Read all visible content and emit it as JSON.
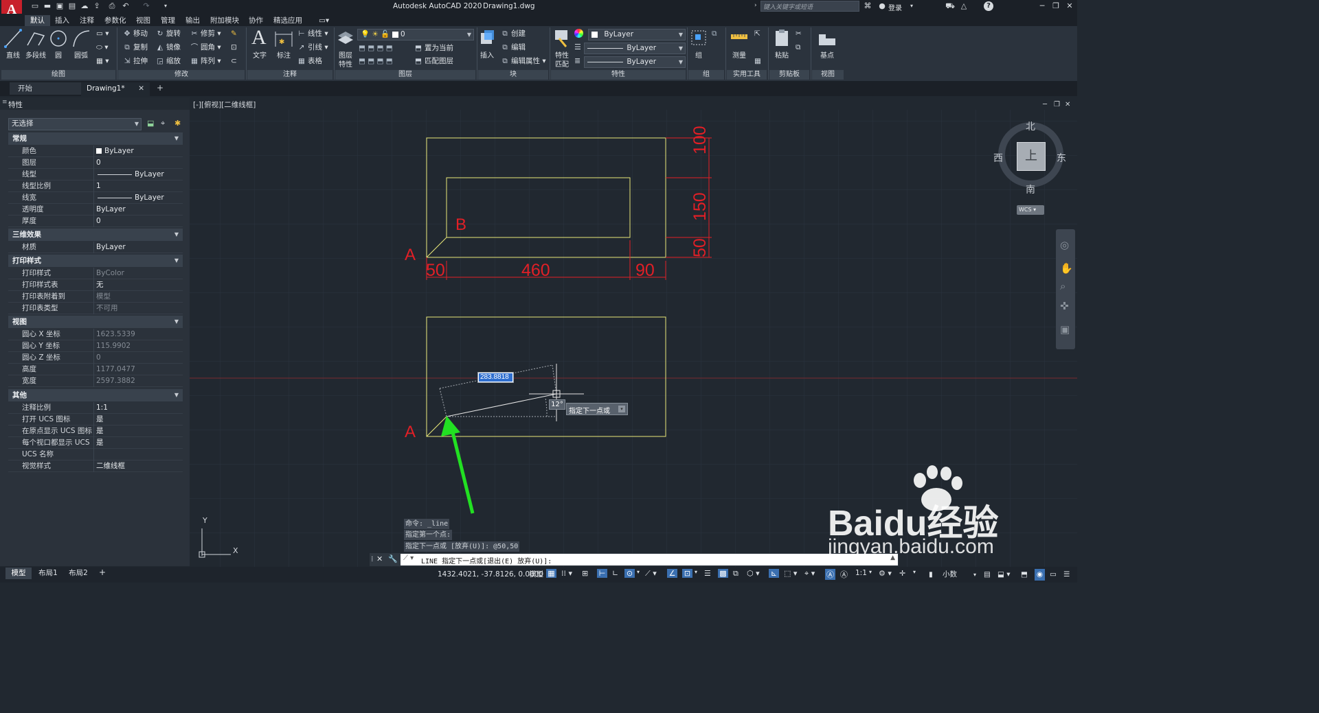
{
  "app": {
    "title": "Autodesk AutoCAD 2020",
    "document": "Drawing1.dwg",
    "search_placeholder": "键入关键字或短语",
    "login": "登录"
  },
  "ribbon_tabs": [
    "默认",
    "插入",
    "注释",
    "参数化",
    "视图",
    "管理",
    "输出",
    "附加模块",
    "协作",
    "精选应用"
  ],
  "draw_panel": {
    "line": "直线",
    "polyline": "多段线",
    "circle": "圆",
    "arc": "圆弧",
    "title": "绘图"
  },
  "modify_panel": {
    "move": "移动",
    "rotate": "旋转",
    "trim": "修剪",
    "copy": "复制",
    "mirror": "镜像",
    "fillet": "圆角",
    "stretch": "拉伸",
    "scale": "缩放",
    "array": "阵列",
    "title": "修改"
  },
  "annotation_panel": {
    "text": "文字",
    "dimension": "标注",
    "linear": "线性",
    "leader": "引线",
    "table": "表格",
    "title": "注释"
  },
  "layers_panel": {
    "layer_props": "图层",
    "layer_props2": "特性",
    "current_layer": "0",
    "make_current": "置为当前",
    "match_layer": "匹配图层",
    "title": "图层"
  },
  "block_panel": {
    "insert": "插入",
    "create": "创建",
    "edit": "编辑",
    "edit_attr": "编辑属性",
    "title": "块"
  },
  "properties_panel": {
    "match": "特性",
    "match2": "匹配",
    "color": "ByLayer",
    "linetype": "ByLayer",
    "lineweight": "ByLayer",
    "title": "特性"
  },
  "groups_panel": {
    "group": "组",
    "title": "组"
  },
  "utilities_panel": {
    "measure": "测量",
    "title": "实用工具"
  },
  "clipboard_panel": {
    "paste": "粘贴",
    "title": "剪贴板"
  },
  "view_panel": {
    "base": "基点",
    "title": "视图"
  },
  "doc_tabs": {
    "start": "开始",
    "drawing": "Drawing1*"
  },
  "properties": {
    "title": "特性",
    "selection": "无选择",
    "general": {
      "title": "常规",
      "rows": [
        [
          "颜色",
          "ByLayer"
        ],
        [
          "图层",
          "0"
        ],
        [
          "线型",
          "ByLayer"
        ],
        [
          "线型比例",
          "1"
        ],
        [
          "线宽",
          "ByLayer"
        ],
        [
          "透明度",
          "ByLayer"
        ],
        [
          "厚度",
          "0"
        ]
      ]
    },
    "three_d": {
      "title": "三维效果",
      "rows": [
        [
          "材质",
          "ByLayer"
        ]
      ]
    },
    "plot": {
      "title": "打印样式",
      "rows": [
        [
          "打印样式",
          "ByColor"
        ],
        [
          "打印样式表",
          "无"
        ],
        [
          "打印表附着到",
          "模型"
        ],
        [
          "打印表类型",
          "不可用"
        ]
      ]
    },
    "view": {
      "title": "视图",
      "rows": [
        [
          "圆心 X 坐标",
          "1623.5339"
        ],
        [
          "圆心 Y 坐标",
          "115.9902"
        ],
        [
          "圆心 Z 坐标",
          "0"
        ],
        [
          "高度",
          "1177.0477"
        ],
        [
          "宽度",
          "2597.3882"
        ]
      ]
    },
    "misc": {
      "title": "其他",
      "rows": [
        [
          "注释比例",
          "1:1"
        ],
        [
          "打开 UCS 图标",
          "是"
        ],
        [
          "在原点显示 UCS 图标",
          "是"
        ],
        [
          "每个视口都显示 UCS",
          "是"
        ],
        [
          "UCS 名称",
          ""
        ],
        [
          "视觉样式",
          "二维线框"
        ]
      ]
    }
  },
  "viewport": {
    "label": "[-][俯视][二维线框]"
  },
  "drawing": {
    "label_a1": "A",
    "label_b": "B",
    "label_a2": "A",
    "dim_50a": "50",
    "dim_460": "460",
    "dim_90": "90",
    "dim_100": "100",
    "dim_150": "150",
    "dim_50b": "50",
    "input_value": "283.8818",
    "angle": "12°",
    "prompt": "指定下一点或"
  },
  "viewcube": {
    "north": "北",
    "south": "南",
    "east": "东",
    "west": "西",
    "top": "上",
    "wcs": "WCS"
  },
  "ucs": {
    "x": "X",
    "y": "Y"
  },
  "command": {
    "history": [
      "命令: _line",
      "指定第一个点:",
      "指定下一点或 [放弃(U)]: @50,50"
    ],
    "current": "LINE 指定下一点或[退出(E) 放弃(U)]:"
  },
  "layout_tabs": [
    "模型",
    "布局1",
    "布局2"
  ],
  "status": {
    "coords": "1432.4021, -37.8126, 0.0000",
    "model": "模型",
    "scale": "1:1",
    "units": "小数"
  },
  "watermark": {
    "brand": "Baidu经验",
    "url": "jingyan.baidu.com"
  },
  "colors": {
    "accent": "#e21f26",
    "geometry": "#e9e878",
    "arrow": "#22e022",
    "bg": "#212830"
  }
}
